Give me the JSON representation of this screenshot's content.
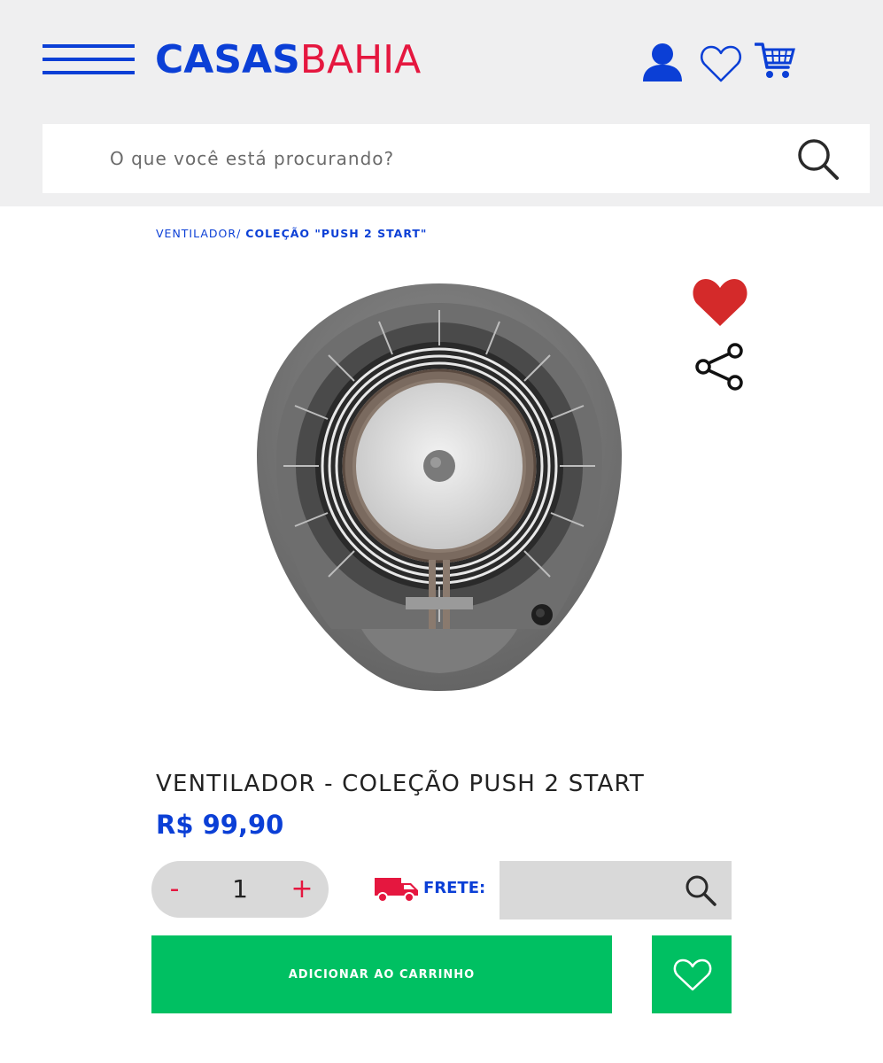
{
  "header": {
    "logo_part1": "CASAS",
    "logo_part2": "BAHIA",
    "icons": [
      "menu-icon",
      "user-icon",
      "heart-icon",
      "cart-icon"
    ]
  },
  "search": {
    "placeholder": "O que você está procurando?",
    "value": ""
  },
  "breadcrumb": {
    "item1": "VENTILADOR/",
    "current": "COLEÇÃO \"PUSH 2 START\""
  },
  "product": {
    "title": "VENTILADOR - COLEÇÃO PUSH 2 START",
    "price": "R$ 99,90",
    "image": "fan-product-image"
  },
  "quantity": {
    "minus_label": "-",
    "value": "1",
    "plus_label": "+"
  },
  "shipping": {
    "label": "FRETE:",
    "value": ""
  },
  "actions": {
    "add_to_cart": "ADICIONAR AO CARRINHO"
  },
  "colors": {
    "brand_blue": "#0b3fd6",
    "brand_red": "#e5173f",
    "buy_green": "#00c062",
    "favorite_red": "#d42a2a"
  }
}
